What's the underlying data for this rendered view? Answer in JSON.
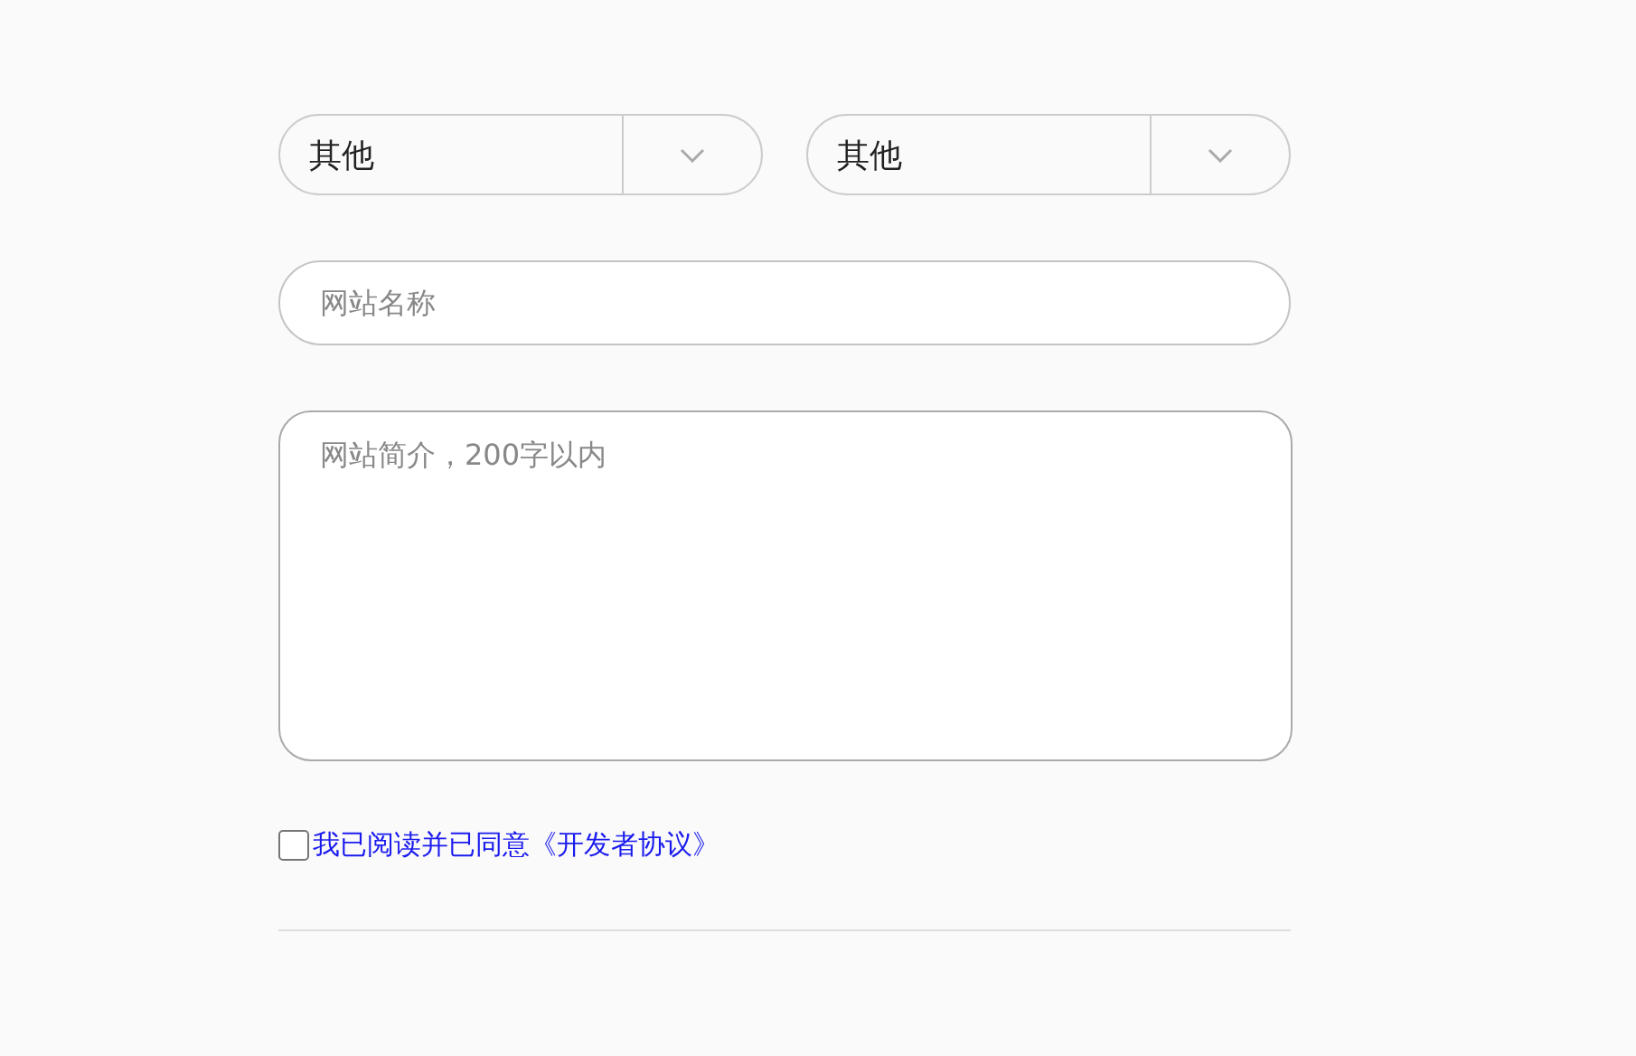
{
  "selects": [
    {
      "value": "其他"
    },
    {
      "value": "其他"
    }
  ],
  "site_name": {
    "placeholder": "网站名称"
  },
  "site_intro": {
    "placeholder": "网站简介，200字以内"
  },
  "agreement": {
    "text": "我已阅读并已同意《开发者协议》",
    "checked": false
  }
}
